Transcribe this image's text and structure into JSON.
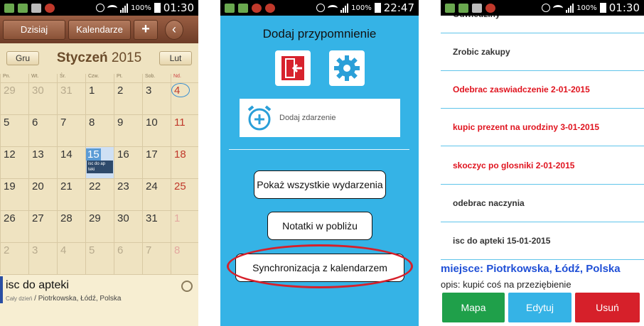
{
  "status_bars": [
    {
      "battery": "100%",
      "time": "01:30"
    },
    {
      "battery": "100%",
      "time": "22:47"
    },
    {
      "battery": "100%",
      "time": "01:30"
    }
  ],
  "calendar": {
    "toolbar": {
      "today": "Dzisiaj",
      "calendars": "Kalendarze",
      "add": "+",
      "back": "‹"
    },
    "prev_month": "Gru",
    "next_month": "Lut",
    "month": "Styczeń",
    "year": "2015",
    "weekdays": [
      "Pn.",
      "Wt.",
      "Śr.",
      "Czw.",
      "Pt.",
      "Sob.",
      "Nd."
    ],
    "weeks": [
      [
        "29",
        "30",
        "31",
        "1",
        "2",
        "3",
        "4"
      ],
      [
        "5",
        "6",
        "7",
        "8",
        "9",
        "10",
        "11"
      ],
      [
        "12",
        "13",
        "14",
        "15",
        "16",
        "17",
        "18"
      ],
      [
        "19",
        "20",
        "21",
        "22",
        "23",
        "24",
        "25"
      ],
      [
        "26",
        "27",
        "28",
        "29",
        "30",
        "31",
        "1"
      ],
      [
        "2",
        "3",
        "4",
        "5",
        "6",
        "7",
        "8"
      ]
    ],
    "today_event_chip": "isc do ap teki",
    "selected_event": {
      "title": "isc do apteki",
      "allday": "Cały dzień",
      "separator": " / ",
      "place": "Piotrkowska, Łódź, Polska"
    }
  },
  "reminder": {
    "title": "Dodaj przypomnienie",
    "add_event": "Dodaj zdarzenie",
    "show_all": "Pokaż wszystkie wydarzenia",
    "nearby": "Notatki w pobliżu",
    "sync": "Synchronizacja z kalendarzem"
  },
  "notes": {
    "items": [
      {
        "text": "Odwiedziny",
        "red": false
      },
      {
        "text": "Zrobic zakupy",
        "red": false
      },
      {
        "text": "Odebrac zaswiadczenie 2-01-2015",
        "red": true
      },
      {
        "text": "kupic prezent na urodziny 3-01-2015",
        "red": true
      },
      {
        "text": "skoczyc po glosniki 2-01-2015",
        "red": true
      },
      {
        "text": "odebrac naczynia",
        "red": false
      },
      {
        "text": "isc do apteki 15-01-2015",
        "red": false
      }
    ],
    "place": "miejsce: Piotrkowska, Łódź, Polska",
    "description": "opis: kupić coś na przeziębienie",
    "buttons": {
      "map": "Mapa",
      "edit": "Edytuj",
      "delete": "Usuń"
    }
  },
  "colors": {
    "accent_blue": "#35b3e6",
    "green": "#1fa04a",
    "red": "#d6202a",
    "brown": "#7a4630"
  }
}
